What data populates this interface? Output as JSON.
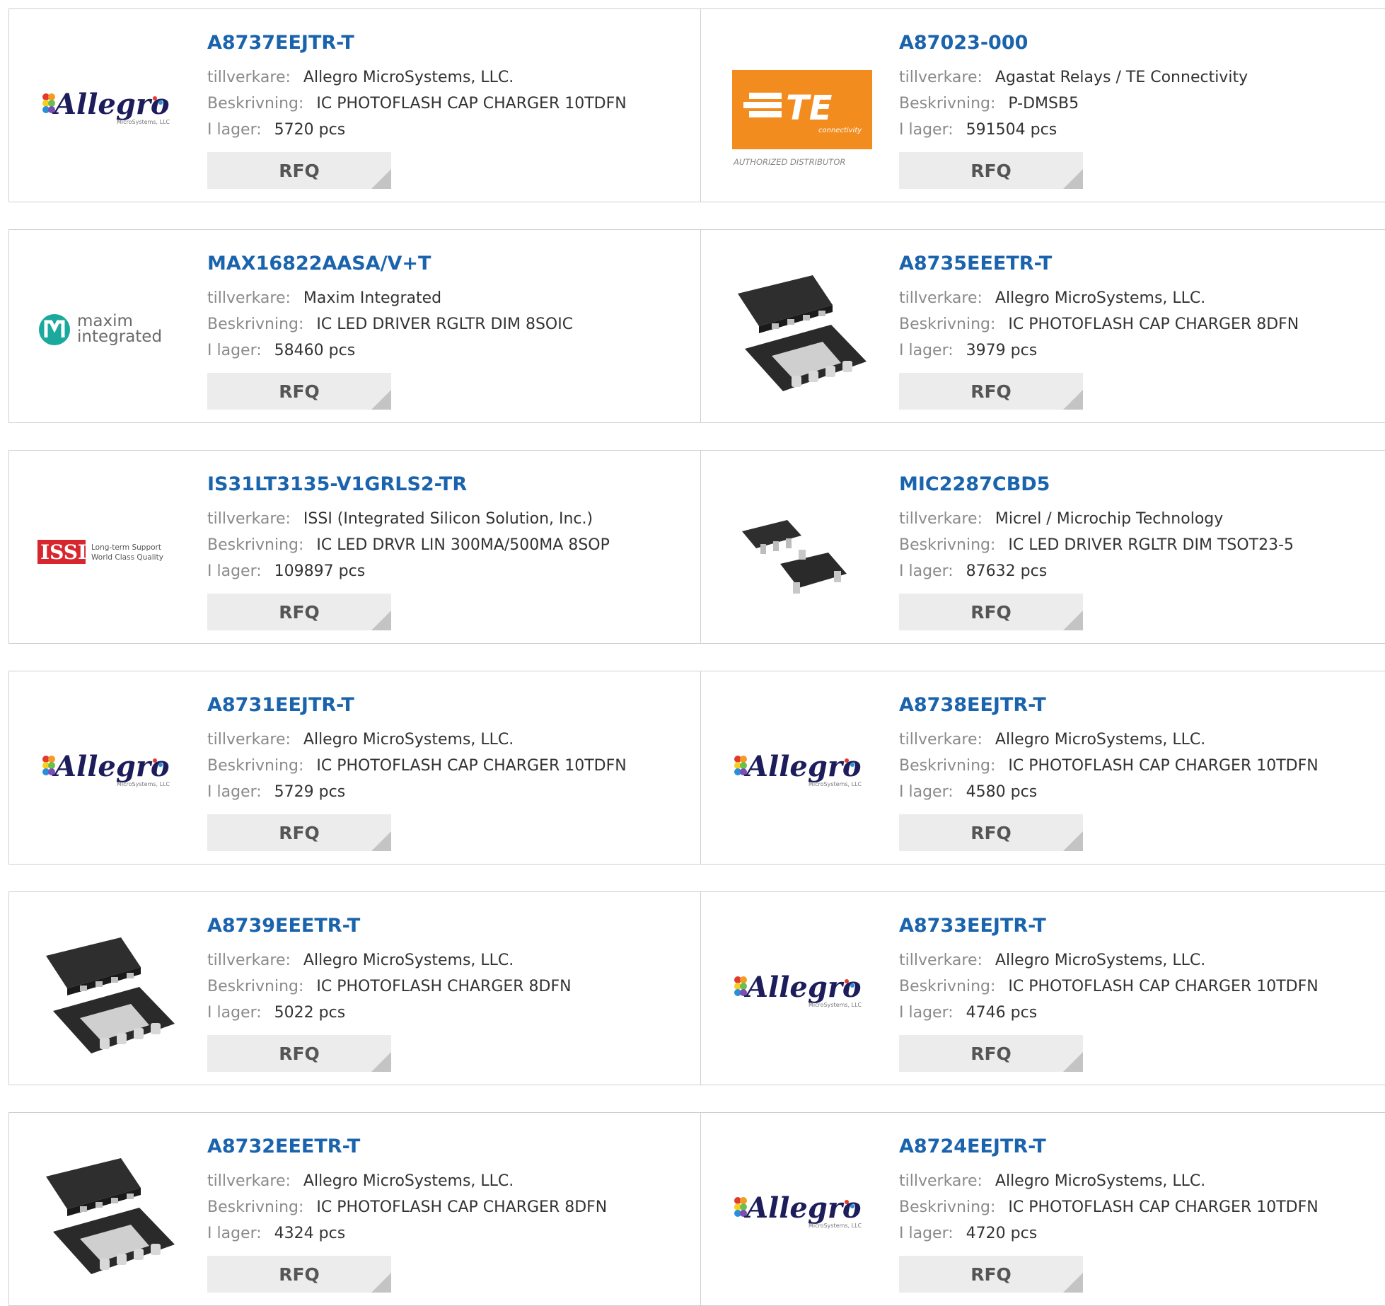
{
  "labels": {
    "manufacturer": "tillverkare:",
    "description": "Beskrivning:",
    "stock": "I lager:",
    "rfq": "RFQ"
  },
  "brand_logos": {
    "allegro": {
      "text": "Allegro",
      "small": "MicroSystems, LLC"
    },
    "te": {
      "text": "TE",
      "sub": "connectivity",
      "caption": "AUTHORIZED DISTRIBUTOR"
    },
    "maxim": {
      "line1": "maxim",
      "line2": "integrated"
    },
    "issi": {
      "text": "ISSI",
      "line1": "Long-term Support",
      "line2": "World Class Quality"
    }
  },
  "products": [
    {
      "part": "A8737EEJTR-T",
      "manufacturer": "Allegro MicroSystems, LLC.",
      "description": "IC PHOTOFLASH CAP CHARGER 10TDFN",
      "stock": "5720 pcs",
      "image": "allegro-logo"
    },
    {
      "part": "A87023-000",
      "manufacturer": "Agastat Relays / TE Connectivity",
      "description": "P-DMSB5",
      "stock": "591504 pcs",
      "image": "te-logo"
    },
    {
      "part": "MAX16822AASA/V+T",
      "manufacturer": "Maxim Integrated",
      "description": "IC LED DRIVER RGLTR DIM 8SOIC",
      "stock": "58460 pcs",
      "image": "maxim-logo"
    },
    {
      "part": "A8735EEETR-T",
      "manufacturer": "Allegro MicroSystems, LLC.",
      "description": "IC PHOTOFLASH CAP CHARGER 8DFN",
      "stock": "3979 pcs",
      "image": "dfn-chip"
    },
    {
      "part": "IS31LT3135-V1GRLS2-TR",
      "manufacturer": "ISSI (Integrated Silicon Solution, Inc.)",
      "description": "IC LED DRVR LIN 300MA/500MA 8SOP",
      "stock": "109897 pcs",
      "image": "issi-logo"
    },
    {
      "part": "MIC2287CBD5",
      "manufacturer": "Micrel / Microchip Technology",
      "description": "IC LED DRIVER RGLTR DIM TSOT23-5",
      "stock": "87632 pcs",
      "image": "sot-chip"
    },
    {
      "part": "A8731EEJTR-T",
      "manufacturer": "Allegro MicroSystems, LLC.",
      "description": "IC PHOTOFLASH CAP CHARGER 10TDFN",
      "stock": "5729 pcs",
      "image": "allegro-logo"
    },
    {
      "part": "A8738EEJTR-T",
      "manufacturer": "Allegro MicroSystems, LLC.",
      "description": "IC PHOTOFLASH CAP CHARGER 10TDFN",
      "stock": "4580 pcs",
      "image": "allegro-logo"
    },
    {
      "part": "A8739EEETR-T",
      "manufacturer": "Allegro MicroSystems, LLC.",
      "description": "IC PHOTOFLASH CHARGER 8DFN",
      "stock": "5022 pcs",
      "image": "dfn-chip"
    },
    {
      "part": "A8733EEJTR-T",
      "manufacturer": "Allegro MicroSystems, LLC.",
      "description": "IC PHOTOFLASH CAP CHARGER 10TDFN",
      "stock": "4746 pcs",
      "image": "allegro-logo"
    },
    {
      "part": "A8732EEETR-T",
      "manufacturer": "Allegro MicroSystems, LLC.",
      "description": "IC PHOTOFLASH CAP CHARGER 8DFN",
      "stock": "4324 pcs",
      "image": "dfn-chip"
    },
    {
      "part": "A8724EEJTR-T",
      "manufacturer": "Allegro MicroSystems, LLC.",
      "description": "IC PHOTOFLASH CAP CHARGER 10TDFN",
      "stock": "4720 pcs",
      "image": "allegro-logo"
    }
  ],
  "colors": {
    "link": "#1a63ad",
    "label": "#8a8a8a",
    "value": "#333333",
    "border": "#cfcfcf",
    "rfq_bg": "#ececec",
    "rfq_text": "#555555",
    "te_orange": "#f28c1f",
    "maxim_teal": "#1aa99c",
    "issi_red": "#d7262e"
  }
}
